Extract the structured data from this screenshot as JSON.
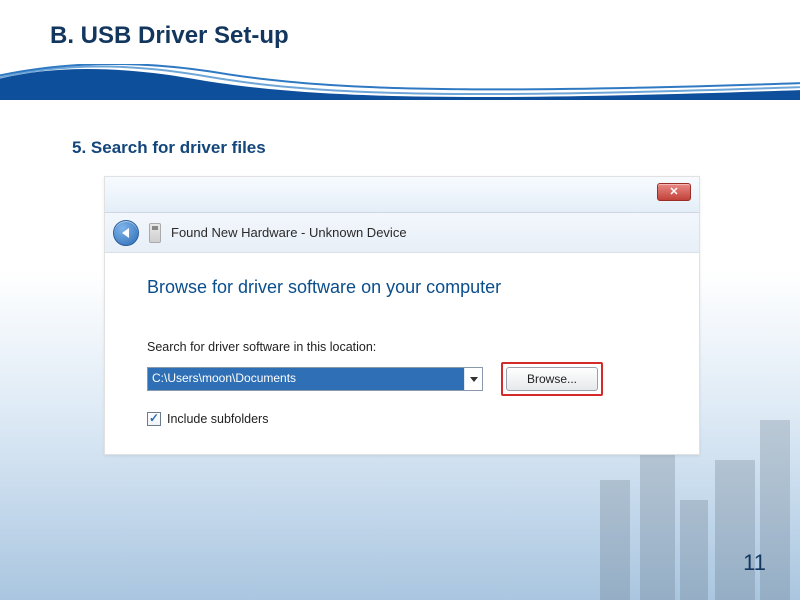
{
  "slide": {
    "title": "B. USB Driver Set-up",
    "step_label": "5. Search for driver files",
    "page_number": "11"
  },
  "dialog": {
    "close_glyph": "✕",
    "header_text": "Found New Hardware - Unknown Device",
    "heading": "Browse for driver software on your computer",
    "location_label": "Search for driver software in this location:",
    "path_value": "C:\\Users\\moon\\Documents",
    "browse_label": "Browse...",
    "include_subfolders_label": "Include subfolders"
  }
}
